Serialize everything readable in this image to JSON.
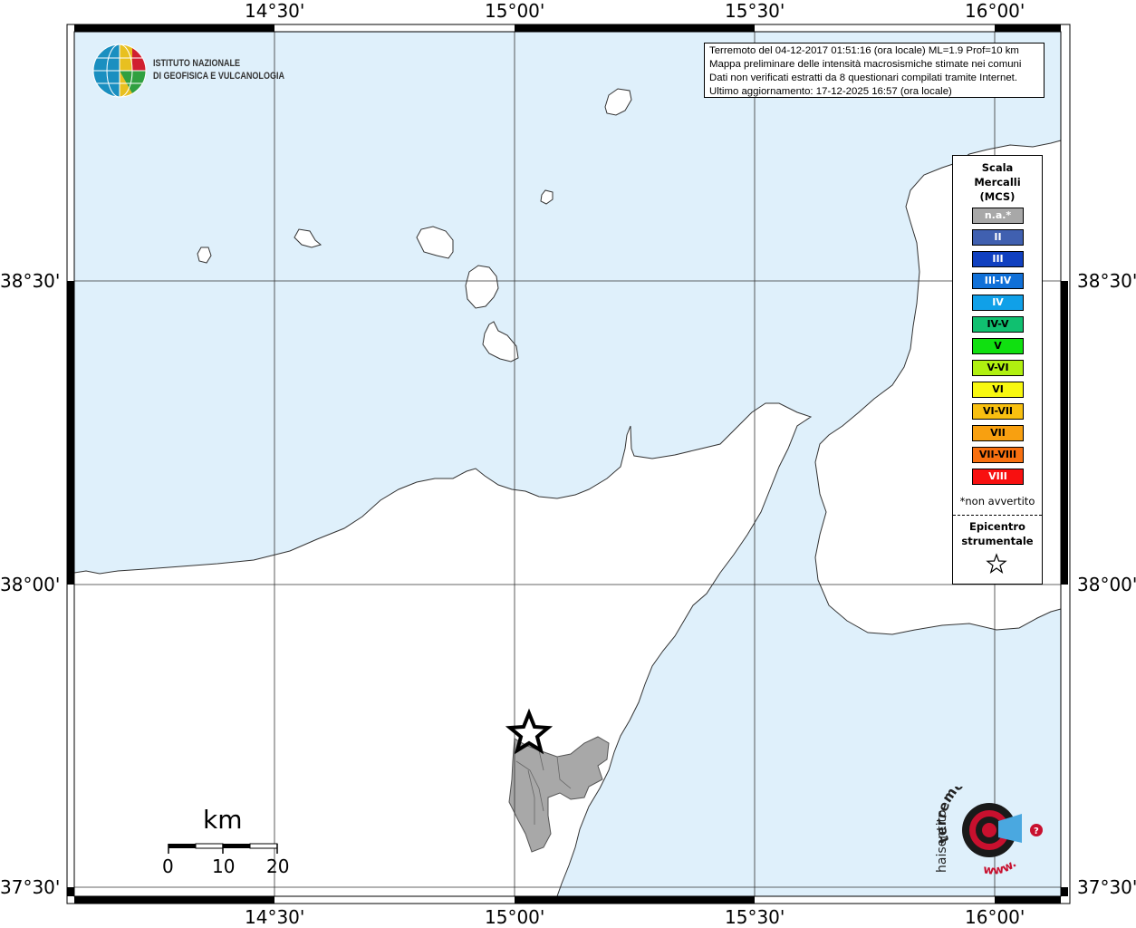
{
  "map": {
    "top_labels": [
      "14°30'",
      "15°00'",
      "15°30'",
      "16°00'"
    ],
    "bottom_labels": [
      "14°30'",
      "15°00'",
      "15°30'",
      "16°00'"
    ],
    "left_labels": [
      "38°30'",
      "38°00'",
      "37°30'"
    ],
    "right_labels": [
      "38°30'",
      "38°00'",
      "37°30'"
    ],
    "colors": {
      "sea": "#dff0fb",
      "land": "#ffffff",
      "felt_area": "#a8a8a8",
      "coast": "#333333"
    }
  },
  "logo": {
    "line1": "ISTITUTO NAZIONALE",
    "line2": "DI GEOFISICA E VULCANOLOGIA"
  },
  "info": {
    "line1": "Terremoto del 04-12-2017 01:51:16 (ora locale) ML=1.9 Prof=10 km",
    "line2": "Mappa preliminare delle intensità macrosismiche stimate nei comuni",
    "line3": "Dati non verificati estratti da 8 questionari compilati tramite Internet.",
    "line4": "Ultimo aggiornamento: 17-12-2025 16:57 (ora locale)"
  },
  "legend": {
    "title_line1": "Scala",
    "title_line2": "Mercalli",
    "title_line3": "(MCS)",
    "items": [
      {
        "label": "n.a.*",
        "color": "#a8a8a8",
        "text_color": "#ffffff"
      },
      {
        "label": "II",
        "color": "#4060b0",
        "text_color": "#ffffff"
      },
      {
        "label": "III",
        "color": "#1040c0",
        "text_color": "#ffffff"
      },
      {
        "label": "III-IV",
        "color": "#1070d8",
        "text_color": "#ffffff"
      },
      {
        "label": "IV",
        "color": "#10a0e8",
        "text_color": "#ffffff"
      },
      {
        "label": "IV-V",
        "color": "#10c070",
        "text_color": "#000000"
      },
      {
        "label": "V",
        "color": "#10e010",
        "text_color": "#000000"
      },
      {
        "label": "V-VI",
        "color": "#b0f010",
        "text_color": "#000000"
      },
      {
        "label": "VI",
        "color": "#f8f810",
        "text_color": "#000000"
      },
      {
        "label": "VI-VII",
        "color": "#f8c010",
        "text_color": "#000000"
      },
      {
        "label": "VII",
        "color": "#f8a010",
        "text_color": "#000000"
      },
      {
        "label": "VII-VIII",
        "color": "#f87010",
        "text_color": "#000000"
      },
      {
        "label": "VIII",
        "color": "#f81010",
        "text_color": "#ffffff"
      }
    ],
    "note": "*non avvertito",
    "epicenter_line1": "Epicentro",
    "epicenter_line2": "strumentale"
  },
  "scale_bar": {
    "unit": "km",
    "ticks": [
      "0",
      "10",
      "20"
    ]
  },
  "watermark": {
    "top_text": "terremoto.it",
    "mid_text": "haisentito",
    "bottom_text": "www."
  }
}
